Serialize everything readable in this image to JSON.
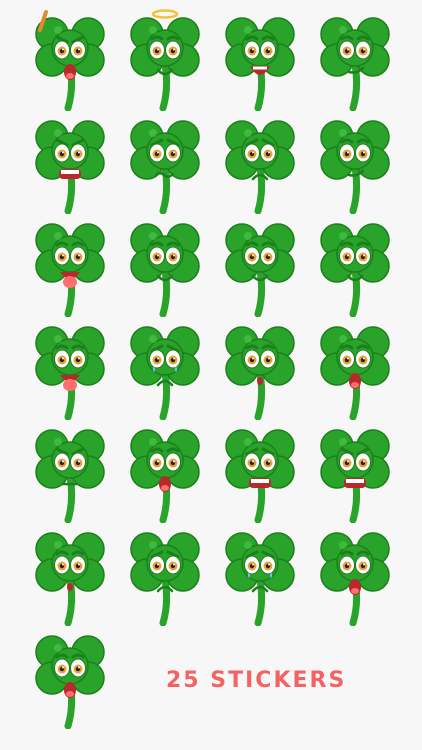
{
  "caption": "25 STICKERS",
  "colors": {
    "background": "#f7f7f7",
    "leaf": "#2aa32a",
    "leaf_dark": "#1c7f1c",
    "leaf_light": "#4fc84f",
    "eye_white": "#ffffff",
    "iris": "#e8a23a",
    "pupil": "#222222",
    "mouth": "#b8282d",
    "tongue": "#ff6f6f",
    "caption": "#f26464"
  },
  "stickers": [
    {
      "mood": "angry",
      "accessory": "pencil",
      "mouth": "open"
    },
    {
      "mood": "angelic",
      "accessory": "halo",
      "mouth": "smile"
    },
    {
      "mood": "excited",
      "accessory": "",
      "mouth": "grin"
    },
    {
      "mood": "smirk",
      "accessory": "",
      "mouth": "smirk"
    },
    {
      "mood": "frustrated",
      "accessory": "",
      "mouth": "teeth"
    },
    {
      "mood": "worried",
      "accessory": "",
      "mouth": "wavy"
    },
    {
      "mood": "sad",
      "accessory": "",
      "mouth": "frown"
    },
    {
      "mood": "calm",
      "accessory": "",
      "mouth": "smirk"
    },
    {
      "mood": "silly",
      "accessory": "",
      "mouth": "tongue"
    },
    {
      "mood": "content",
      "accessory": "",
      "mouth": "smile"
    },
    {
      "mood": "content",
      "accessory": "",
      "mouth": "smile"
    },
    {
      "mood": "happy",
      "accessory": "",
      "mouth": "smile"
    },
    {
      "mood": "dizzy",
      "accessory": "",
      "mouth": "tongue"
    },
    {
      "mood": "crying",
      "accessory": "",
      "mouth": "frown"
    },
    {
      "mood": "shy",
      "accessory": "",
      "mouth": "small"
    },
    {
      "mood": "shocked",
      "accessory": "",
      "mouth": "open"
    },
    {
      "mood": "annoyed",
      "accessory": "",
      "mouth": "flat"
    },
    {
      "mood": "surprised",
      "accessory": "",
      "mouth": "open"
    },
    {
      "mood": "nervous",
      "accessory": "",
      "mouth": "teeth"
    },
    {
      "mood": "angry",
      "accessory": "",
      "mouth": "teeth"
    },
    {
      "mood": "surprised",
      "accessory": "",
      "mouth": "small"
    },
    {
      "mood": "sad",
      "accessory": "",
      "mouth": "frown"
    },
    {
      "mood": "crying",
      "accessory": "",
      "mouth": "frown"
    },
    {
      "mood": "shocked",
      "accessory": "",
      "mouth": "open"
    },
    {
      "mood": "scared",
      "accessory": "",
      "mouth": "open"
    }
  ]
}
